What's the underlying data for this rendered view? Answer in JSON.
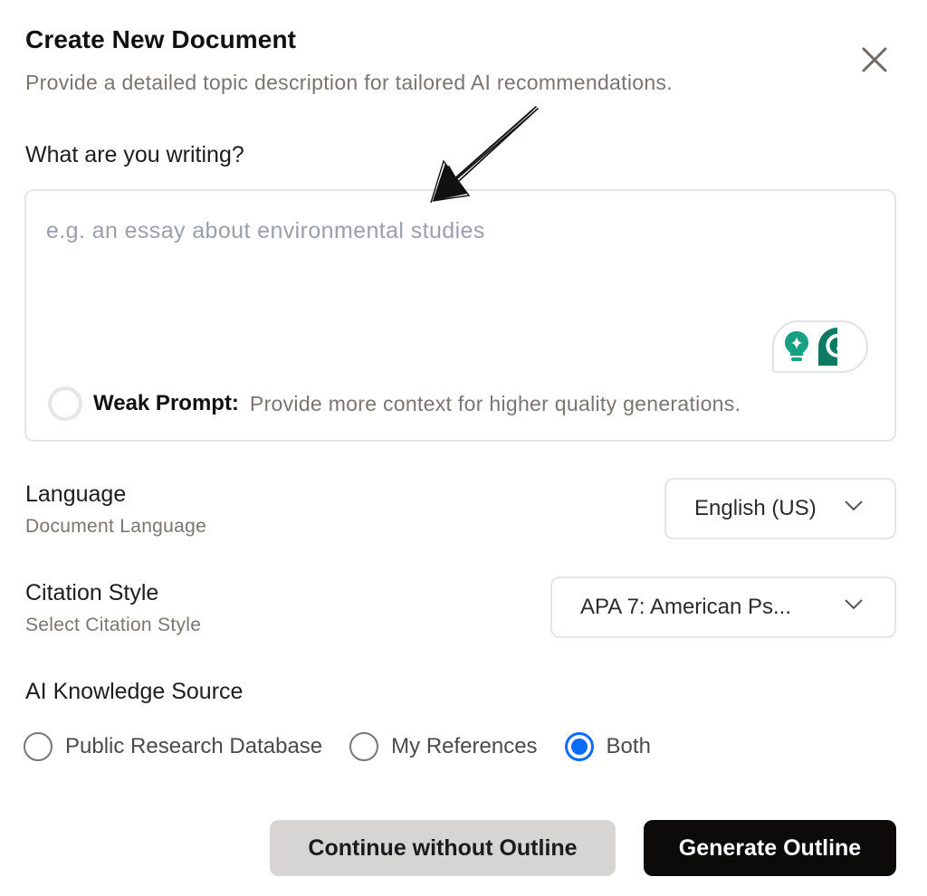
{
  "dialog": {
    "title": "Create New Document",
    "subtitle": "Provide a detailed topic description for tailored AI recommendations.",
    "close_icon": "close-icon"
  },
  "topic": {
    "label": "What are you writing?",
    "value": "",
    "placeholder": "e.g. an essay about environmental studies",
    "widget_icons": [
      "lightbulb-sparkle-icon",
      "grammarly-g-icon"
    ],
    "widget_colors": {
      "bulb": "#17a084",
      "grammarly": "#0d7a64"
    },
    "strength": {
      "label": "Weak Prompt:",
      "message": "Provide more context for higher quality generations."
    }
  },
  "language": {
    "label": "Language",
    "sublabel": "Document Language",
    "selected": "English (US)"
  },
  "citation": {
    "label": "Citation Style",
    "sublabel": "Select Citation Style",
    "selected": "APA 7: American Ps..."
  },
  "knowledge_source": {
    "label": "AI Knowledge Source",
    "options": [
      {
        "label": "Public Research Database",
        "checked": false
      },
      {
        "label": "My References",
        "checked": false
      },
      {
        "label": "Both",
        "checked": true
      }
    ],
    "accent_color": "#0a6cff"
  },
  "actions": {
    "secondary_label": "Continue without Outline",
    "primary_label": "Generate Outline"
  }
}
